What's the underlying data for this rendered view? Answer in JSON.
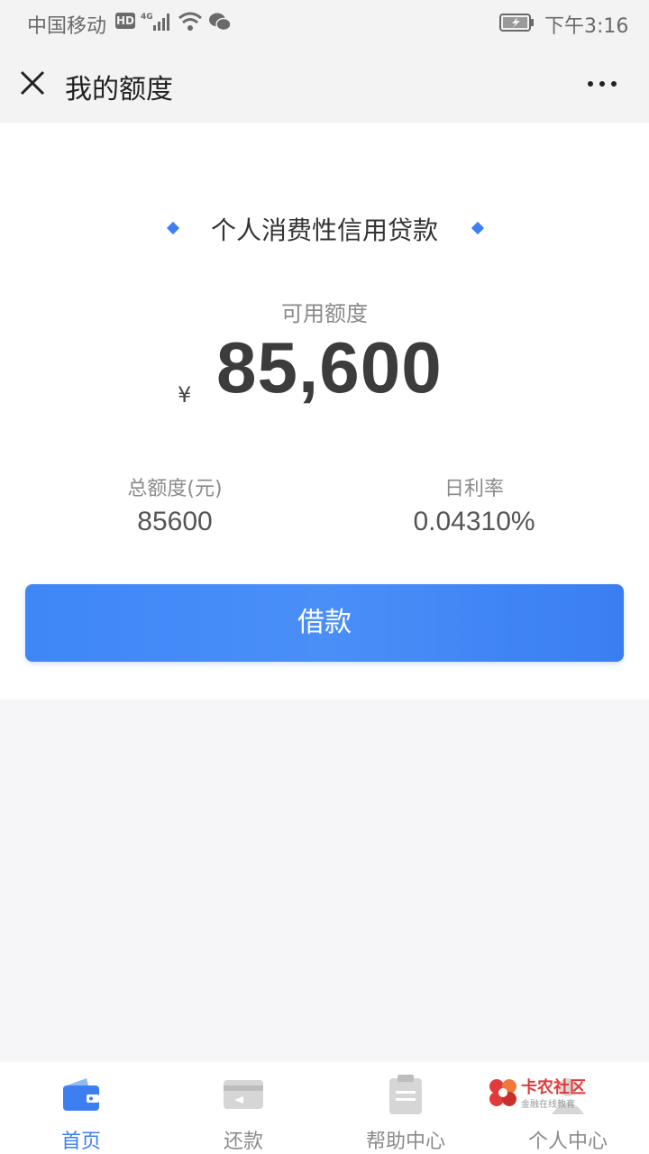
{
  "status_bar": {
    "carrier": "中国移动",
    "hd_badge": "HD",
    "network": "4G",
    "time": "下午3:16"
  },
  "nav": {
    "title": "我的额度"
  },
  "loan": {
    "product_title": "个人消费性信用贷款",
    "available_label": "可用额度",
    "currency_symbol": "¥",
    "available_amount": "85,600",
    "total_label": "总额度(元)",
    "total_value": "85600",
    "rate_label": "日利率",
    "rate_value": "0.04310%",
    "borrow_button": "借款"
  },
  "tabs": [
    {
      "label": "首页",
      "icon": "wallet-icon",
      "active": true
    },
    {
      "label": "还款",
      "icon": "card-icon",
      "active": false
    },
    {
      "label": "帮助中心",
      "icon": "clipboard-icon",
      "active": false
    },
    {
      "label": "个人中心",
      "icon": "person-icon",
      "active": false
    }
  ],
  "watermark": {
    "brand": "卡农社区",
    "slogan": "金融在线教育"
  },
  "colors": {
    "accent": "#3d7ff0",
    "button": "#4a8ff8",
    "watermark_red": "#e23a3a"
  }
}
